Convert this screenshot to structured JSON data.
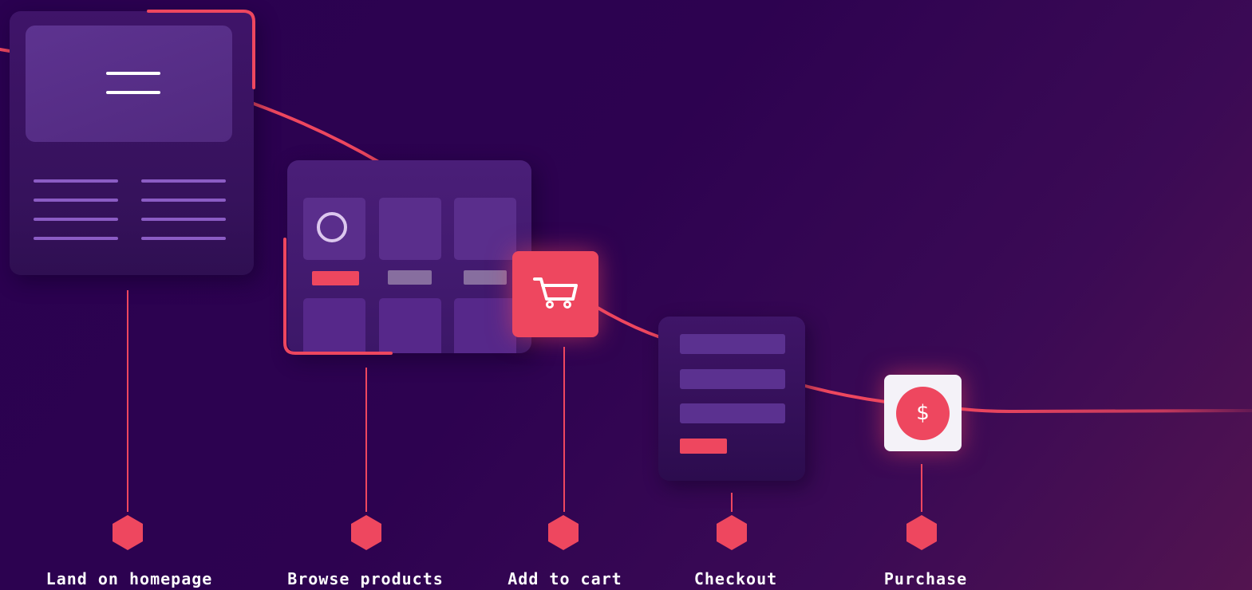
{
  "diagram": {
    "accent_color": "#ee475f",
    "background_colors": [
      "#2a0150",
      "#531450"
    ],
    "purchase_symbol": "$",
    "steps": [
      {
        "label": "Land on homepage",
        "illustration": "homepage-wireframe"
      },
      {
        "label": "Browse products",
        "illustration": "product-grid"
      },
      {
        "label": "Add to cart",
        "illustration": "cart-icon"
      },
      {
        "label": "Checkout",
        "illustration": "checkout-form"
      },
      {
        "label": "Purchase",
        "illustration": "dollar-coin-icon"
      }
    ]
  }
}
